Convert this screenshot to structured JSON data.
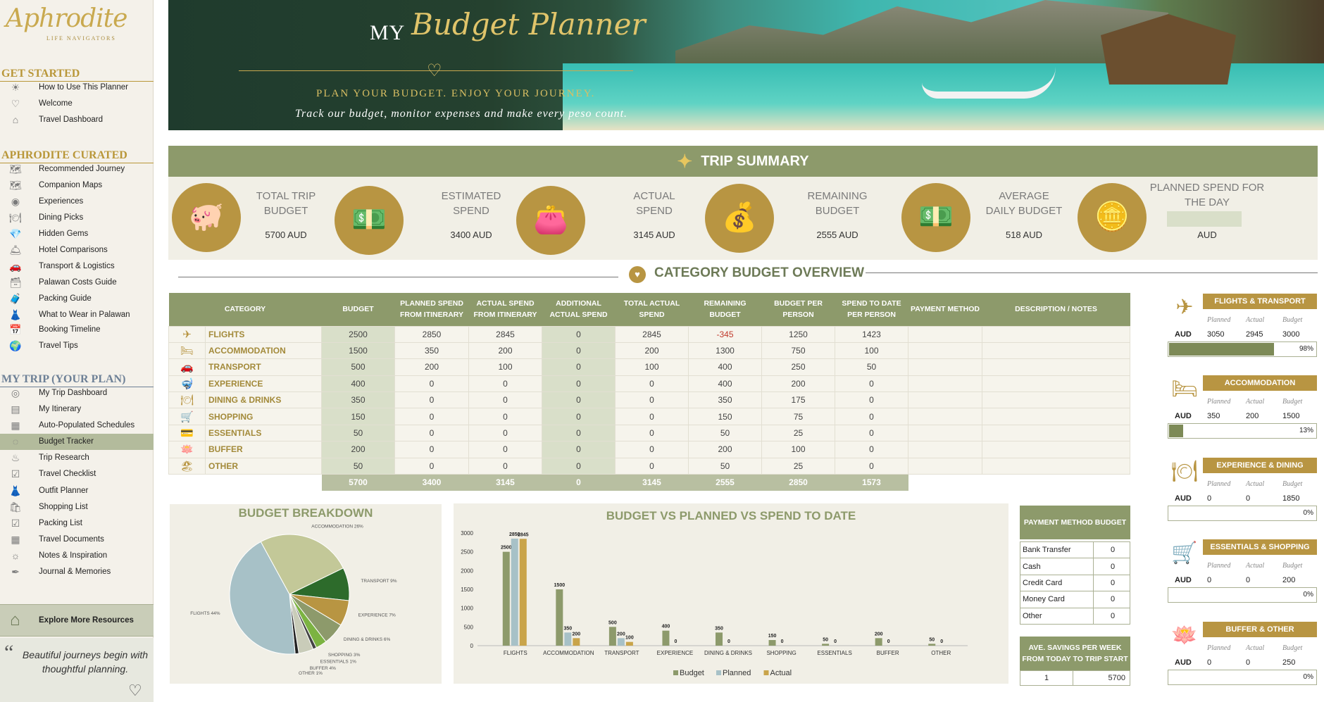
{
  "logo": {
    "name": "Aphrodite",
    "tagline": "LIFE NAVIGATORS"
  },
  "sidebar": {
    "sections": [
      {
        "title": "GET STARTED",
        "items": [
          "How to Use This Planner",
          "Welcome",
          "Travel Dashboard"
        ]
      },
      {
        "title": "APHRODITE CURATED",
        "items": [
          "Recommended Journey",
          "Companion Maps",
          "Experiences",
          "Dining Picks",
          "Hidden Gems",
          "Hotel Comparisons",
          "Transport & Logistics",
          "Palawan Costs Guide",
          "Packing Guide",
          "What to Wear in Palawan",
          "Booking Timeline",
          "Travel Tips"
        ]
      },
      {
        "title": "MY TRIP (YOUR PLAN)",
        "items": [
          "My Trip Dashboard",
          "My Itinerary",
          "Auto-Populated Schedules",
          "Budget Tracker",
          "Trip Research",
          "Travel Checklist",
          "Outfit Planner",
          "Shopping List",
          "Packing List",
          "Travel Documents",
          "Notes & Inspiration",
          "Journal & Memories"
        ]
      }
    ],
    "explore": "Explore More Resources",
    "quote": "Beautiful journeys begin with thoughtful planning."
  },
  "hero": {
    "my": "MY",
    "title": "Budget Planner",
    "tagline": "PLAN YOUR BUDGET. ENJOY YOUR JOURNEY.",
    "subtitle": "Track our budget, monitor expenses and make every peso count."
  },
  "summary": {
    "title": "TRIP SUMMARY",
    "items": [
      {
        "label1": "TOTAL TRIP",
        "label2": "BUDGET",
        "value": "5700 AUD"
      },
      {
        "label1": "ESTIMATED",
        "label2": "SPEND",
        "value": "3400 AUD"
      },
      {
        "label1": "ACTUAL",
        "label2": "SPEND",
        "value": "3145 AUD"
      },
      {
        "label1": "REMAINING",
        "label2": "BUDGET",
        "value": "2555 AUD"
      },
      {
        "label1": "AVERAGE",
        "label2": "DAILY BUDGET",
        "value": "518 AUD"
      },
      {
        "label1": "PLANNED SPEND FOR",
        "label2": "THE DAY",
        "value": "AUD"
      }
    ]
  },
  "category": {
    "title": "CATEGORY BUDGET OVERVIEW",
    "headers": [
      "CATEGORY",
      "BUDGET",
      "PLANNED SPEND FROM ITINERARY",
      "ACTUAL SPEND FROM ITINERARY",
      "ADDITIONAL ACTUAL SPEND",
      "TOTAL ACTUAL SPEND",
      "REMAINING BUDGET",
      "BUDGET PER PERSON",
      "SPEND TO DATE PER PERSON",
      "PAYMENT METHOD",
      "DESCRIPTION / NOTES"
    ],
    "rows": [
      [
        "FLIGHTS",
        "2500",
        "2850",
        "2845",
        "0",
        "2845",
        "-345",
        "1250",
        "1423"
      ],
      [
        "ACCOMMODATION",
        "1500",
        "350",
        "200",
        "0",
        "200",
        "1300",
        "750",
        "100"
      ],
      [
        "TRANSPORT",
        "500",
        "200",
        "100",
        "0",
        "100",
        "400",
        "250",
        "50"
      ],
      [
        "EXPERIENCE",
        "400",
        "0",
        "0",
        "0",
        "0",
        "400",
        "200",
        "0"
      ],
      [
        "DINING & DRINKS",
        "350",
        "0",
        "0",
        "0",
        "0",
        "350",
        "175",
        "0"
      ],
      [
        "SHOPPING",
        "150",
        "0",
        "0",
        "0",
        "0",
        "150",
        "75",
        "0"
      ],
      [
        "ESSENTIALS",
        "50",
        "0",
        "0",
        "0",
        "0",
        "50",
        "25",
        "0"
      ],
      [
        "BUFFER",
        "200",
        "0",
        "0",
        "0",
        "0",
        "200",
        "100",
        "0"
      ],
      [
        "OTHER",
        "50",
        "0",
        "0",
        "0",
        "0",
        "50",
        "25",
        "0"
      ]
    ],
    "icons": [
      "plane-icon",
      "bed-icon",
      "car-icon",
      "snorkel-icon",
      "dining-icon",
      "cart-icon",
      "wallet-icon",
      "lotus-icon",
      "beach-icon"
    ],
    "totals": [
      "5700",
      "3400",
      "3145",
      "0",
      "3145",
      "2555",
      "2850",
      "1573"
    ]
  },
  "pie": {
    "title": "BUDGET BREAKDOWN"
  },
  "bars": {
    "title": "BUDGET VS PLANNED VS SPEND TO DATE"
  },
  "chart_data": [
    {
      "type": "pie",
      "title": "BUDGET BREAKDOWN",
      "labels": [
        "ACCOMMODATION",
        "TRANSPORT",
        "EXPERIENCE",
        "DINING & DRINKS",
        "SHOPPING",
        "ESSENTIALS",
        "BUFFER",
        "OTHER",
        "FLIGHTS"
      ],
      "values": [
        26,
        9,
        7,
        6,
        3,
        1,
        4,
        1,
        44
      ],
      "label_texts": [
        "ACCOMMODATION 26%",
        "TRANSPORT 9%",
        "EXPERIENCE 7%",
        "DINING & DRINKS 6%",
        "SHOPPING 3%",
        "ESSENTIALS 1%",
        "BUFFER 4%",
        "OTHER 1%",
        "FLIGHTS 44%"
      ],
      "colors": [
        "#c3c898",
        "#2d6b2b",
        "#b89542",
        "#8d9a6b",
        "#7cb342",
        "#444444",
        "#c9ccb9",
        "#222222",
        "#a7c1c7"
      ]
    },
    {
      "type": "bar",
      "title": "BUDGET VS PLANNED VS SPEND TO DATE",
      "categories": [
        "FLIGHTS",
        "ACCOMMODATION",
        "TRANSPORT",
        "EXPERIENCE",
        "DINING & DRINKS",
        "SHOPPING",
        "ESSENTIALS",
        "BUFFER",
        "OTHER"
      ],
      "series": [
        {
          "name": "Budget",
          "color": "#8d9a6b",
          "values": [
            2500,
            1500,
            500,
            400,
            350,
            150,
            50,
            200,
            50
          ]
        },
        {
          "name": "Planned",
          "color": "#a7c1c7",
          "values": [
            2850,
            350,
            200,
            0,
            0,
            0,
            0,
            0,
            0
          ]
        },
        {
          "name": "Actual",
          "color": "#c9a44a",
          "values": [
            2845,
            200,
            100,
            0,
            0,
            0,
            0,
            0,
            0
          ]
        }
      ],
      "ylim": [
        0,
        3000
      ],
      "yticks": [
        0,
        500,
        1000,
        1500,
        2000,
        2500,
        3000
      ]
    }
  ],
  "payment": {
    "title": "PAYMENT METHOD BUDGET",
    "rows": [
      [
        "Bank Transfer",
        "0"
      ],
      [
        "Cash",
        "0"
      ],
      [
        "Credit Card",
        "0"
      ],
      [
        "Money Card",
        "0"
      ],
      [
        "Other",
        "0"
      ]
    ]
  },
  "savings": {
    "title1": "AVE. SAVINGS PER WEEK",
    "title2": "FROM TODAY TO TRIP START",
    "weeks": "1",
    "value": "5700"
  },
  "cards": [
    {
      "title": "FLIGHTS & TRANSPORT",
      "icon": "plane-icon",
      "planned": "3050",
      "actual": "2945",
      "budget": "3000",
      "pct": "98%",
      "fill": 0.98
    },
    {
      "title": "ACCOMMODATION",
      "icon": "bed-icon",
      "planned": "350",
      "actual": "200",
      "budget": "1500",
      "pct": "13%",
      "fill": 0.13
    },
    {
      "title": "EXPERIENCE & DINING",
      "icon": "dining-icon",
      "planned": "0",
      "actual": "0",
      "budget": "1850",
      "pct": "0%",
      "fill": 0
    },
    {
      "title": "ESSENTIALS & SHOPPING",
      "icon": "cart-icon",
      "planned": "0",
      "actual": "0",
      "budget": "200",
      "pct": "0%",
      "fill": 0
    },
    {
      "title": "BUFFER & OTHER",
      "icon": "lotus-icon",
      "planned": "0",
      "actual": "0",
      "budget": "250",
      "pct": "0%",
      "fill": 0
    }
  ],
  "card_labels": {
    "planned": "Planned",
    "actual": "Actual",
    "budget": "Budget",
    "currency": "AUD"
  }
}
